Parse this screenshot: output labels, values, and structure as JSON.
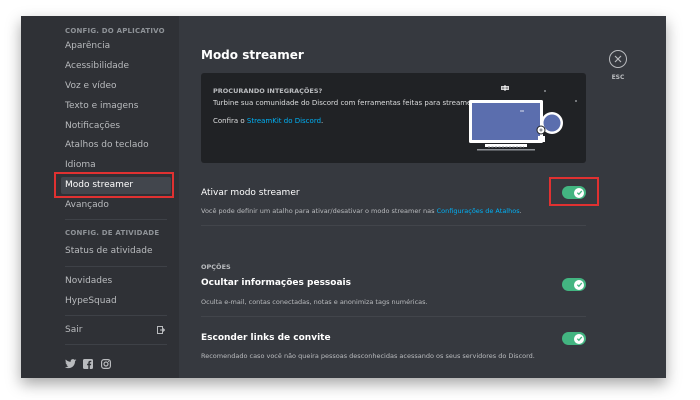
{
  "sidebar": {
    "app_settings_header": "CONFIG. DO APLICATIVO",
    "app_items": [
      {
        "label": "Aparência"
      },
      {
        "label": "Acessibilidade"
      },
      {
        "label": "Voz e vídeo"
      },
      {
        "label": "Texto e imagens"
      },
      {
        "label": "Notificações"
      },
      {
        "label": "Atalhos do teclado"
      },
      {
        "label": "Idioma"
      },
      {
        "label": "Modo streamer",
        "selected": true
      },
      {
        "label": "Avançado"
      }
    ],
    "activity_header": "CONFIG. DE ATIVIDADE",
    "activity_items": [
      {
        "label": "Status de atividade"
      }
    ],
    "extra_items": [
      {
        "label": "Novidades"
      },
      {
        "label": "HypeSquad"
      }
    ],
    "logout_label": "Sair",
    "social_icons": [
      "twitter-icon",
      "facebook-icon",
      "instagram-icon"
    ]
  },
  "main": {
    "title": "Modo streamer",
    "close_label": "ESC",
    "promo": {
      "heading": "PROCURANDO INTEGRAÇÕES?",
      "description": "Turbine sua comunidade do Discord com ferramentas feitas para streamers.",
      "link_prefix": "Confira o ",
      "link_text": "StreamKit do Discord",
      "link_suffix": "."
    },
    "enable_streamer": {
      "label": "Ativar modo streamer",
      "description_prefix": "Você pode definir um atalho para ativar/desativar o modo streamer nas ",
      "description_link": "Configurações de Atalhos",
      "description_suffix": ".",
      "enabled": true
    },
    "options_header": "OPÇÕES",
    "options": [
      {
        "label": "Ocultar informações pessoais",
        "description": "Oculta e-mail, contas conectadas, notas e anonimiza tags numéricas.",
        "enabled": true
      },
      {
        "label": "Esconder links de convite",
        "description": "Recomendado caso você não queira pessoas desconhecidas acessando os seus servidores do Discord.",
        "enabled": true
      }
    ]
  },
  "colors": {
    "toggle_on": "#43b581",
    "highlight": "#e03131",
    "link": "#00b0f4"
  }
}
